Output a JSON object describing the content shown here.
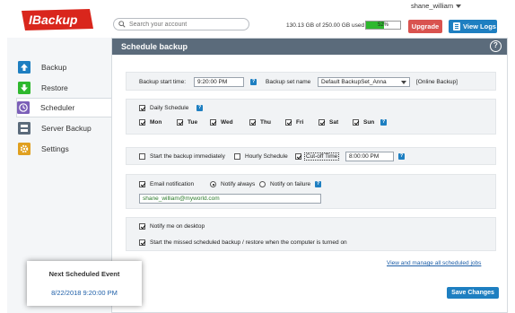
{
  "brand": {
    "logo_text": "IBackup"
  },
  "search": {
    "placeholder": "Search your account"
  },
  "user": {
    "name": "shane_william"
  },
  "usage": {
    "text": "130.13 GB of 250.00 GB used",
    "percent_label": "52%",
    "percent": 52
  },
  "buttons": {
    "upgrade": "Upgrade",
    "view_logs": "View Logs",
    "save": "Save Changes"
  },
  "sidebar": {
    "items": [
      {
        "label": "Backup",
        "icon": "backup-arrow-up-icon",
        "color": "#1e7fc1"
      },
      {
        "label": "Restore",
        "icon": "restore-arrow-down-icon",
        "color": "#2eb82e"
      },
      {
        "label": "Scheduler",
        "icon": "clock-icon",
        "color": "#7b5fb8"
      },
      {
        "label": "Server Backup",
        "icon": "server-icon",
        "color": "#5b6b7b"
      },
      {
        "label": "Settings",
        "icon": "gear-icon",
        "color": "#e0a020"
      }
    ]
  },
  "next_event": {
    "title": "Next Scheduled Event",
    "datetime": "8/22/2018 9:20:00 PM"
  },
  "panel": {
    "title": "Schedule backup",
    "help": "?"
  },
  "schedule": {
    "start_time_label": "Backup start time:",
    "start_time": "9:20:00 PM",
    "set_name_label": "Backup set name",
    "set_name": "Default BackupSet_Anna",
    "set_type": "[Online Backup]",
    "daily_label": "Daily Schedule",
    "days": [
      "Mon",
      "Tue",
      "Wed",
      "Thu",
      "Fri",
      "Sat",
      "Sun"
    ],
    "start_immediately": "Start the backup immediately",
    "hourly": "Hourly Schedule",
    "cutoff_label": "Cut-off Time",
    "cutoff_time": "8:00:00 PM",
    "email_label": "Email notification",
    "notify_always": "Notify always",
    "notify_failure": "Notify on failure",
    "email": "shane_william@myworld.com",
    "desktop_notify": "Notify me on desktop",
    "missed": "Start the missed scheduled backup / restore when the computer is turned on",
    "view_link": "View and manage all scheduled jobs"
  },
  "colors": {
    "header": "#5b6b7b",
    "accent": "#1e7fc1",
    "upgrade": "#d9534f",
    "quota": "#2eb82e"
  }
}
